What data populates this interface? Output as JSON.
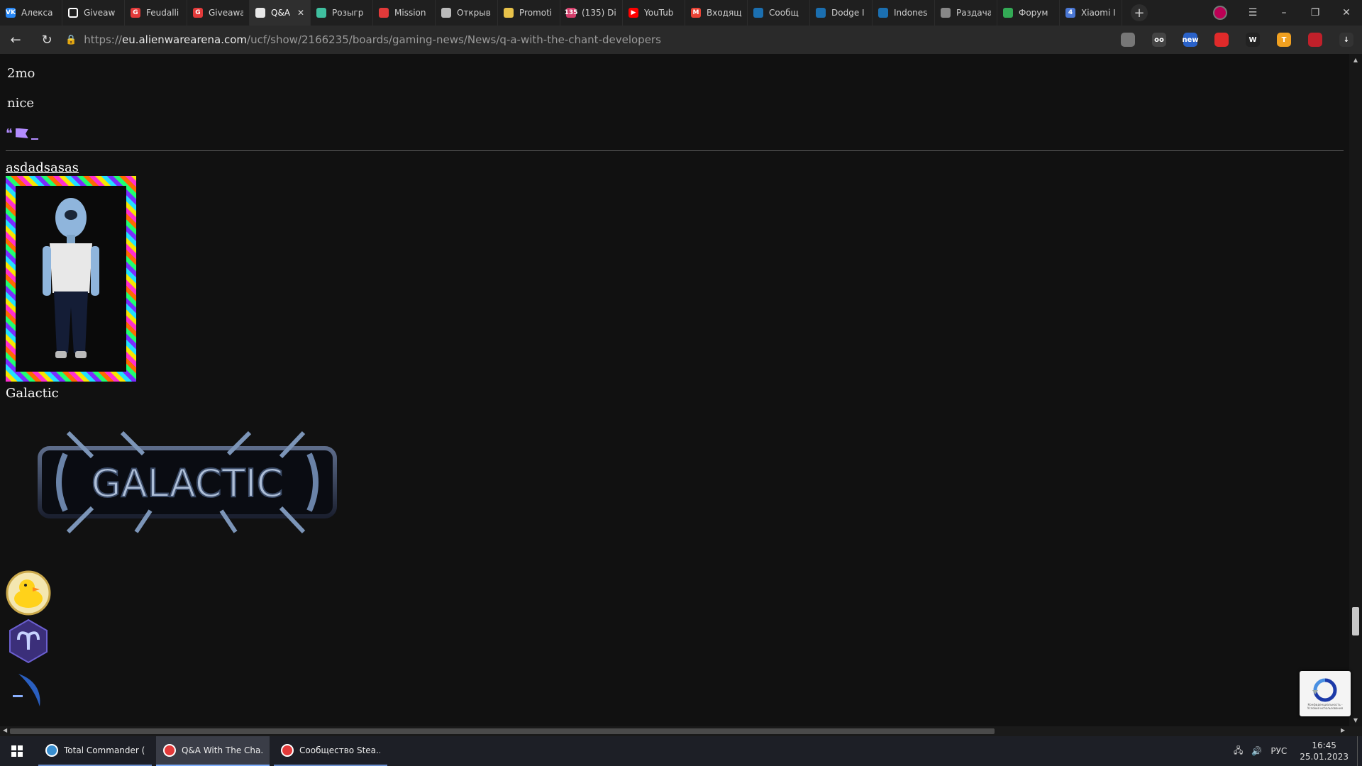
{
  "tabs": [
    {
      "title": "Алекса",
      "icon": "vk-icon",
      "color": "#2787f5",
      "glyph": "VK"
    },
    {
      "title": "Giveaw",
      "icon": "square-icon",
      "color": "#ffffff",
      "glyph": ""
    },
    {
      "title": "Feudalli",
      "icon": "g-icon",
      "color": "#e33a3a",
      "glyph": "G"
    },
    {
      "title": "Giveawa",
      "icon": "g-icon",
      "color": "#e33a3a",
      "glyph": "G"
    },
    {
      "title": "Q&A",
      "icon": "alien-icon",
      "color": "#e8e8e8",
      "glyph": "",
      "active": true
    },
    {
      "title": "Розыгр",
      "icon": "globe-icon",
      "color": "#3fbf9f",
      "glyph": ""
    },
    {
      "title": "Mission",
      "icon": "mountain-icon",
      "color": "#e33a3a",
      "glyph": ""
    },
    {
      "title": "Открыв",
      "icon": "ship-icon",
      "color": "#bbbbbb",
      "glyph": ""
    },
    {
      "title": "Promoti",
      "icon": "coin-icon",
      "color": "#e8c24a",
      "glyph": ""
    },
    {
      "title": "(135) Di",
      "icon": "badge-icon",
      "color": "#d33d6a",
      "glyph": "135"
    },
    {
      "title": "YouTub",
      "icon": "youtube-icon",
      "color": "#ff0000",
      "glyph": "▶"
    },
    {
      "title": "Входящ",
      "icon": "gmail-icon",
      "color": "#ea4335",
      "glyph": "M"
    },
    {
      "title": "Сообщ",
      "icon": "steam-icon",
      "color": "#1b6fb0",
      "glyph": ""
    },
    {
      "title": "Dodge I",
      "icon": "steam-icon",
      "color": "#1b6fb0",
      "glyph": ""
    },
    {
      "title": "Indones",
      "icon": "steam-icon",
      "color": "#1b6fb0",
      "glyph": ""
    },
    {
      "title": "Раздача",
      "icon": "shield-icon",
      "color": "#888888",
      "glyph": ""
    },
    {
      "title": "Форум",
      "icon": "leaf-icon",
      "color": "#33aa55",
      "glyph": ""
    },
    {
      "title": "Xiaomi I",
      "icon": "four-icon",
      "color": "#4a77d4",
      "glyph": "4"
    }
  ],
  "address": {
    "prefix": "https://",
    "domain": "eu.alienwarearena.com",
    "path": "/ucf/show/2166235/boards/gaming-news/News/q-a-with-the-chant-developers"
  },
  "extensions": [
    {
      "icon": "bookmark-icon",
      "color": "#777777",
      "glyph": ""
    },
    {
      "icon": "mask-icon",
      "color": "#444444",
      "glyph": "oo"
    },
    {
      "icon": "new-badge-icon",
      "color": "#2a62c9",
      "glyph": "new"
    },
    {
      "icon": "hand-icon",
      "color": "#e02a2a",
      "glyph": ""
    },
    {
      "icon": "w-icon",
      "color": "#222222",
      "glyph": "W"
    },
    {
      "icon": "t-icon",
      "color": "#f0a020",
      "glyph": "T"
    },
    {
      "icon": "red-extension-icon",
      "color": "#c0202a",
      "glyph": ""
    },
    {
      "icon": "download-icon",
      "color": "#333333",
      "glyph": "↓"
    }
  ],
  "post": {
    "age": "2mo",
    "comment": "nice",
    "quote_glyph": "❝"
  },
  "user": {
    "username": "asdadsasas",
    "rank": "Galactic",
    "badge_text": "GALACTIC"
  },
  "taskbar": {
    "apps": [
      {
        "label": "Total Commander (...",
        "icon": "total-commander-icon",
        "color": "#3a8fd0"
      },
      {
        "label": "Q&A With The Cha...",
        "icon": "yandex-browser-icon",
        "color": "#e33a3a",
        "active": true
      },
      {
        "label": "Сообщество Stea...",
        "icon": "yandex-browser-icon",
        "color": "#e33a3a"
      }
    ],
    "lang": "РУС",
    "time": "16:45",
    "date": "25.01.2023"
  },
  "recaptcha": {
    "text": "Конфиденциальность - Условия использования"
  },
  "colors": {
    "accent_purple": "#b38cff",
    "page_bg": "#111111"
  }
}
